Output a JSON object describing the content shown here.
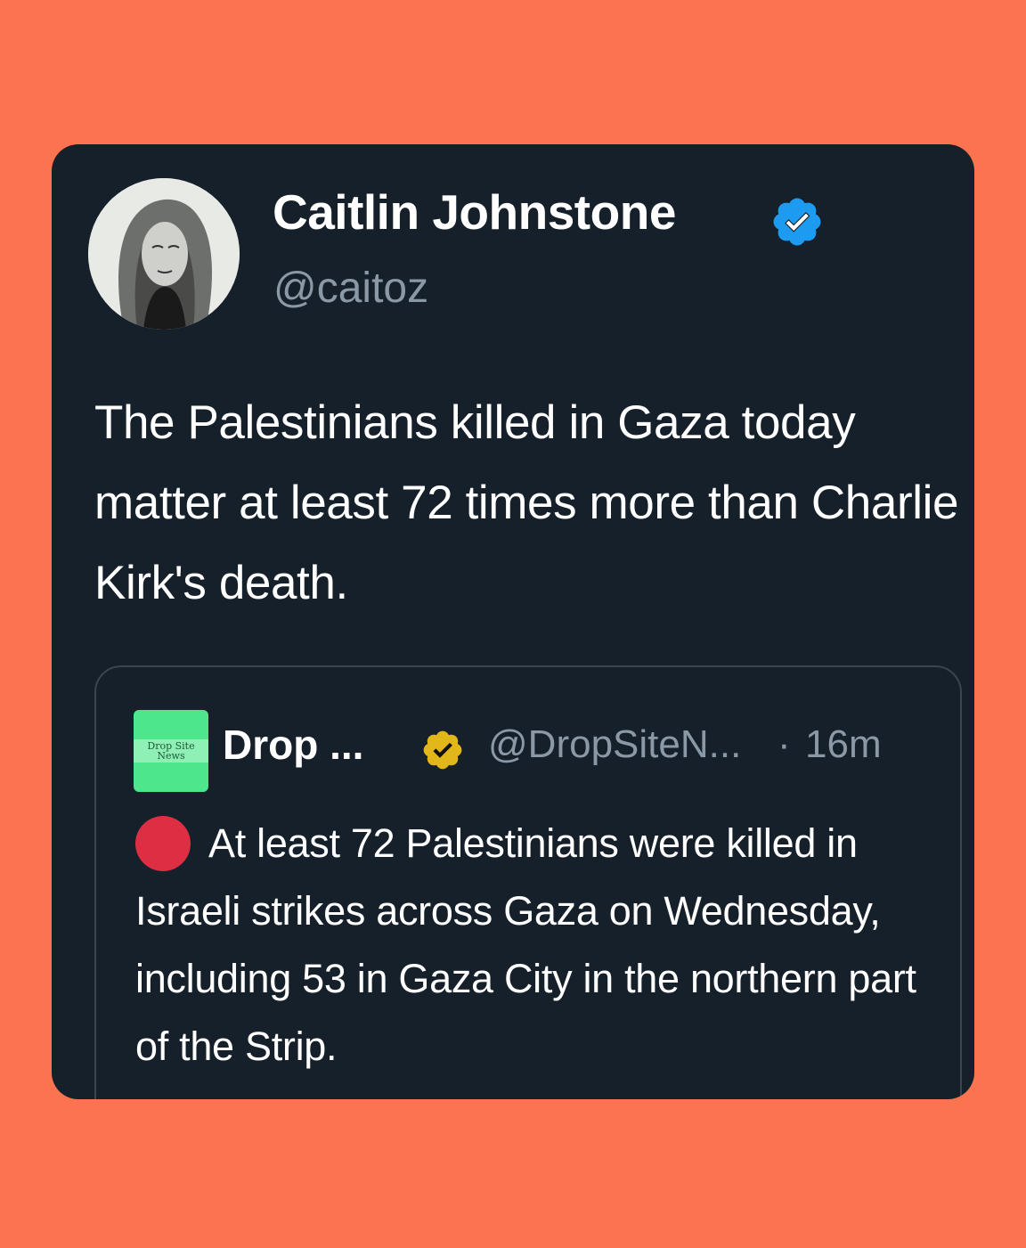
{
  "page": {
    "background": "#fb744f",
    "card_background": "#16202a"
  },
  "tweet": {
    "display_name": "Caitlin Johnstone",
    "handle": "@caitoz",
    "verified_icon": "verified-badge-blue",
    "text": "The Palestinians killed in Gaza today matter at least 72 times more than Charlie Kirk's death."
  },
  "quoted_tweet": {
    "logo_text": "Drop Site News",
    "display_name": "Drop ...",
    "verified_icon": "verified-badge-gold",
    "handle": "@DropSiteN...",
    "separator": "·",
    "time": "16m",
    "emoji": "red-circle",
    "text": "At least 72 Palestinians were killed in Israeli strikes across Gaza on Wednesday, including 53 in Gaza City in the northern part of the Strip."
  },
  "colors": {
    "verified_blue": "#1d9bf0",
    "verified_gold": "#e2b719",
    "muted_text": "#8b98a5",
    "red_circle": "#dd2e44"
  }
}
